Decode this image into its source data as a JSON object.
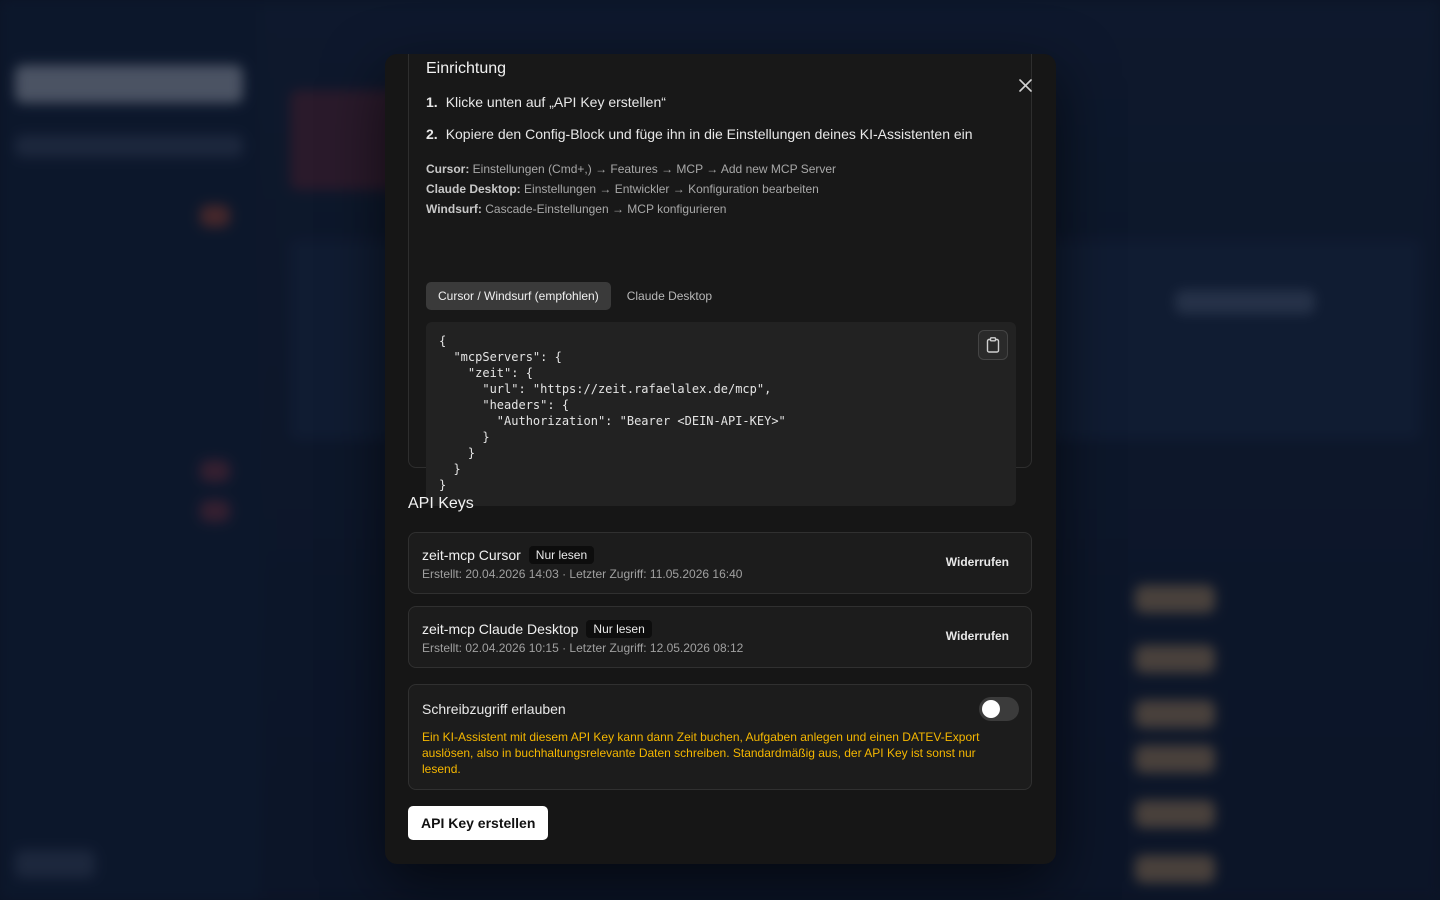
{
  "setup": {
    "title": "Einrichtung",
    "steps": [
      {
        "num": "1.",
        "text": "Klicke unten auf „API Key erstellen“"
      },
      {
        "num": "2.",
        "text": "Kopiere den Config-Block und füge ihn in die Einstellungen deines KI-Assistenten ein"
      }
    ],
    "hints": [
      {
        "label": "Cursor:",
        "text": " Einstellungen (Cmd+,) → Features → MCP → Add new MCP Server"
      },
      {
        "label": "Claude Desktop:",
        "text": " Einstellungen → Entwickler → Konfiguration bearbeiten"
      },
      {
        "label": "Windsurf:",
        "text": " Cascade-Einstellungen → MCP konfigurieren"
      }
    ],
    "tabs": [
      {
        "label": "Cursor / Windsurf (empfohlen)",
        "active": true
      },
      {
        "label": "Claude Desktop",
        "active": false
      }
    ],
    "code": "{\n  \"mcpServers\": {\n    \"zeit\": {\n      \"url\": \"https://zeit.rafaelalex.de/mcp\",\n      \"headers\": {\n        \"Authorization\": \"Bearer <DEIN-API-KEY>\"\n      }\n    }\n  }\n}",
    "copy_icon": "clipboard-icon"
  },
  "api_keys": {
    "title": "API Keys",
    "items": [
      {
        "name": "zeit-mcp Cursor",
        "badge": "Nur lesen",
        "meta": "Erstellt: 20.04.2026 14:03 · Letzter Zugriff: 11.05.2026 16:40",
        "action": "Widerrufen"
      },
      {
        "name": "zeit-mcp Claude Desktop",
        "badge": "Nur lesen",
        "meta": "Erstellt: 02.04.2026 10:15 · Letzter Zugriff: 12.05.2026 08:12",
        "action": "Widerrufen"
      }
    ]
  },
  "write_access": {
    "title": "Schreibzugriff erlauben",
    "enabled": false,
    "description": "Ein KI-Assistent mit diesem API Key kann dann Zeit buchen, Aufgaben anlegen und einen DATEV-Export auslösen, also in buchhaltungsrelevante Daten schreiben. Standardmäßig aus, der API Key ist sonst nur lesend."
  },
  "create_button": "API Key erstellen",
  "colors": {
    "warning": "#f5b700",
    "modal_bg": "#161616",
    "backdrop": "#0e1a2e"
  }
}
